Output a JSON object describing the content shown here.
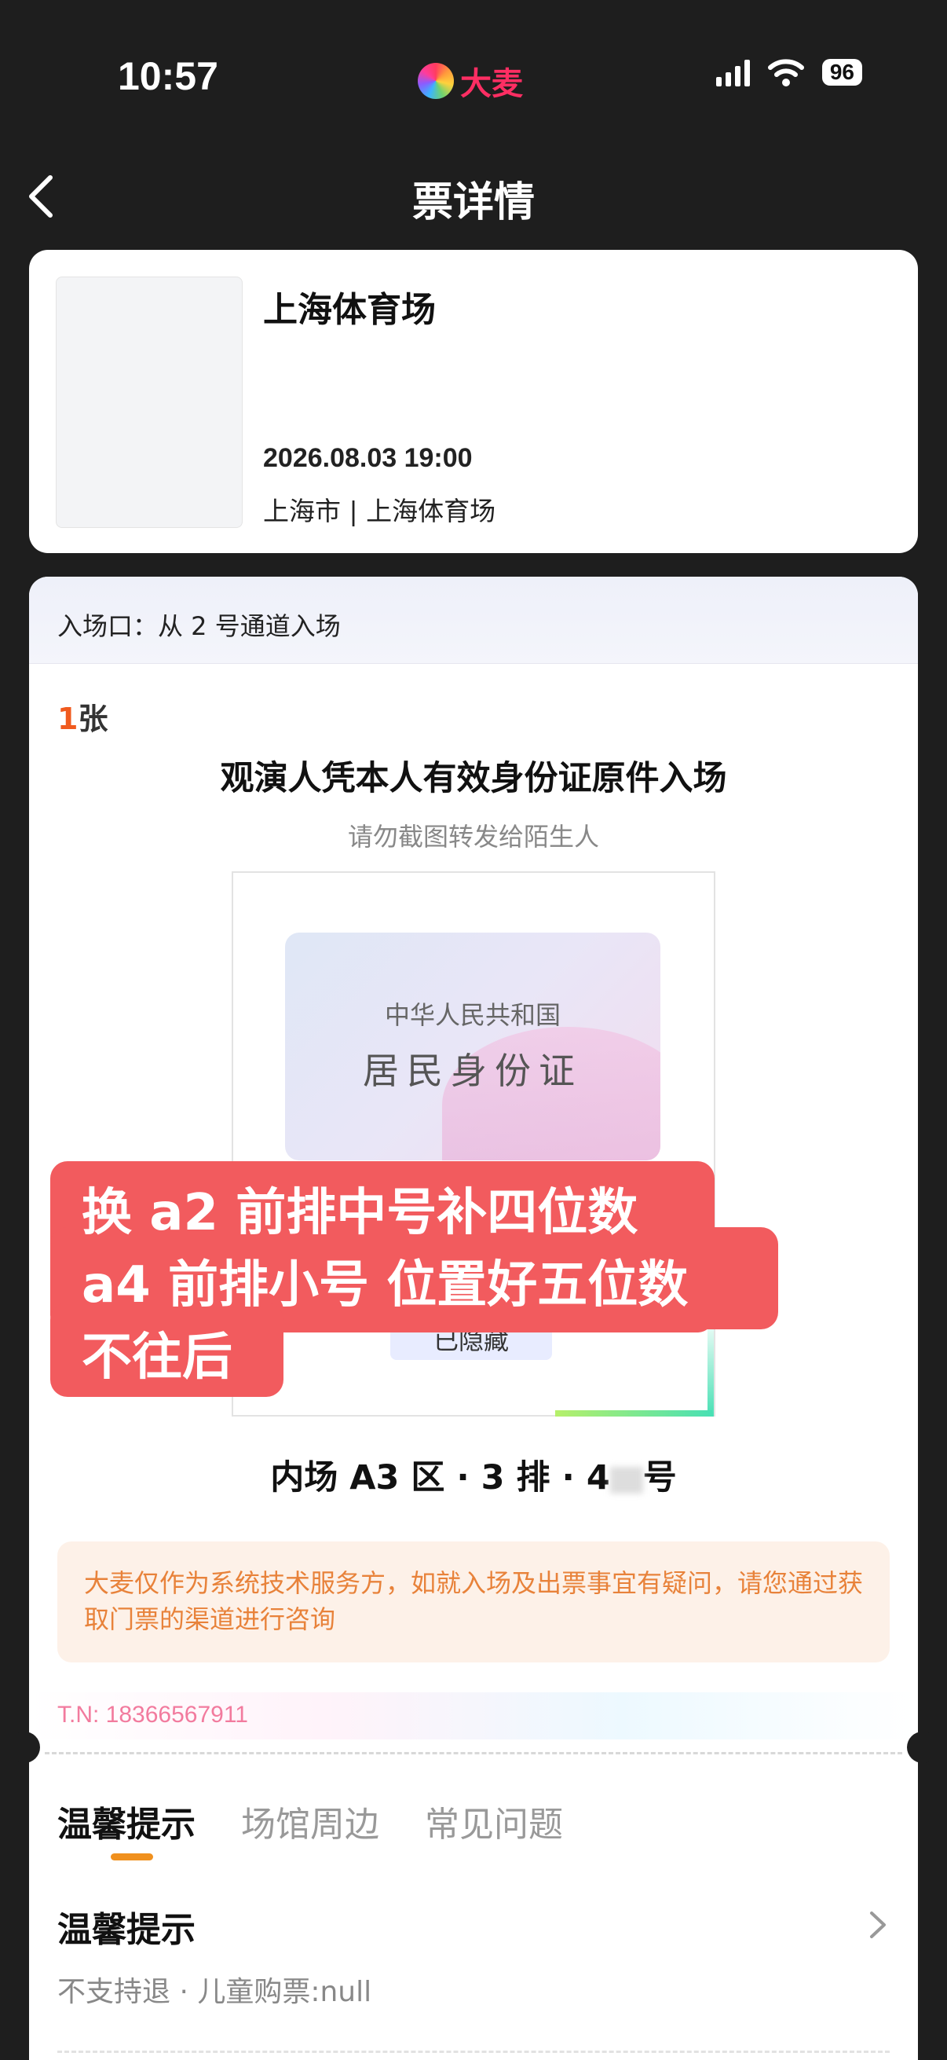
{
  "status_bar": {
    "time": "10:57",
    "brand": "大麦",
    "battery": "96"
  },
  "header": {
    "title": "票详情"
  },
  "event": {
    "name": "上海体育场",
    "datetime": "2026.08.03 19:00",
    "location": "上海市 | 上海体育场"
  },
  "ticket": {
    "entrance": "入场口：从 2 号通道入场",
    "count_num": "1",
    "count_unit": "张",
    "id_notice": "观演人凭本人有效身份证原件入场",
    "screenshot_warning": "请勿截图转发给陌生人",
    "id_card_line1": "中华人民共和国",
    "id_card_line2": "居民身份证",
    "hidden_label": "已隐藏",
    "seat_prefix": "内场 A3 区 · 3 排 · 4",
    "seat_suffix": "号",
    "disclaimer": "大麦仅作为系统技术服务方，如就入场及出票事宜有疑问，请您通过获取门票的渠道进行咨询",
    "tn": "T.N: 18366567911"
  },
  "tabs": [
    {
      "label": "温馨提示",
      "active": true
    },
    {
      "label": "场馆周边",
      "active": false
    },
    {
      "label": "常见问题",
      "active": false
    }
  ],
  "tips": {
    "title": "温馨提示",
    "body": "不支持退 · 儿童购票:null"
  },
  "overlay_note": {
    "line1": "换 a2 前排中号补四位数",
    "line2": "a4 前排小号 位置好五位数",
    "line3": "不往后"
  },
  "colors": {
    "accent_orange": "#f0901e",
    "overlay_red": "#f25b5e",
    "brand_pink": "#ff2e63"
  }
}
